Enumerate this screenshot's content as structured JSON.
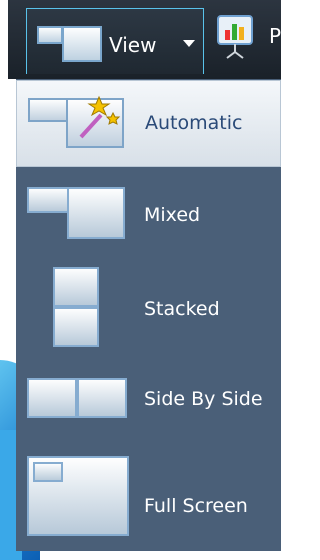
{
  "toolbar": {
    "view_label": "View",
    "present_label": "P"
  },
  "menu": {
    "items": [
      {
        "label": "Automatic",
        "icon": "automatic-layout-icon",
        "selected": true
      },
      {
        "label": "Mixed",
        "icon": "mixed-layout-icon",
        "selected": false
      },
      {
        "label": "Stacked",
        "icon": "stacked-layout-icon",
        "selected": false
      },
      {
        "label": "Side By Side",
        "icon": "side-by-side-layout-icon",
        "selected": false
      },
      {
        "label": "Full Screen",
        "icon": "full-screen-layout-icon",
        "selected": false
      }
    ]
  },
  "colors": {
    "menu_background": "#4a5f78",
    "toolbar_background": "#1f2831",
    "selected_item": "#e8eef4",
    "accent_border": "#59c2ea"
  }
}
